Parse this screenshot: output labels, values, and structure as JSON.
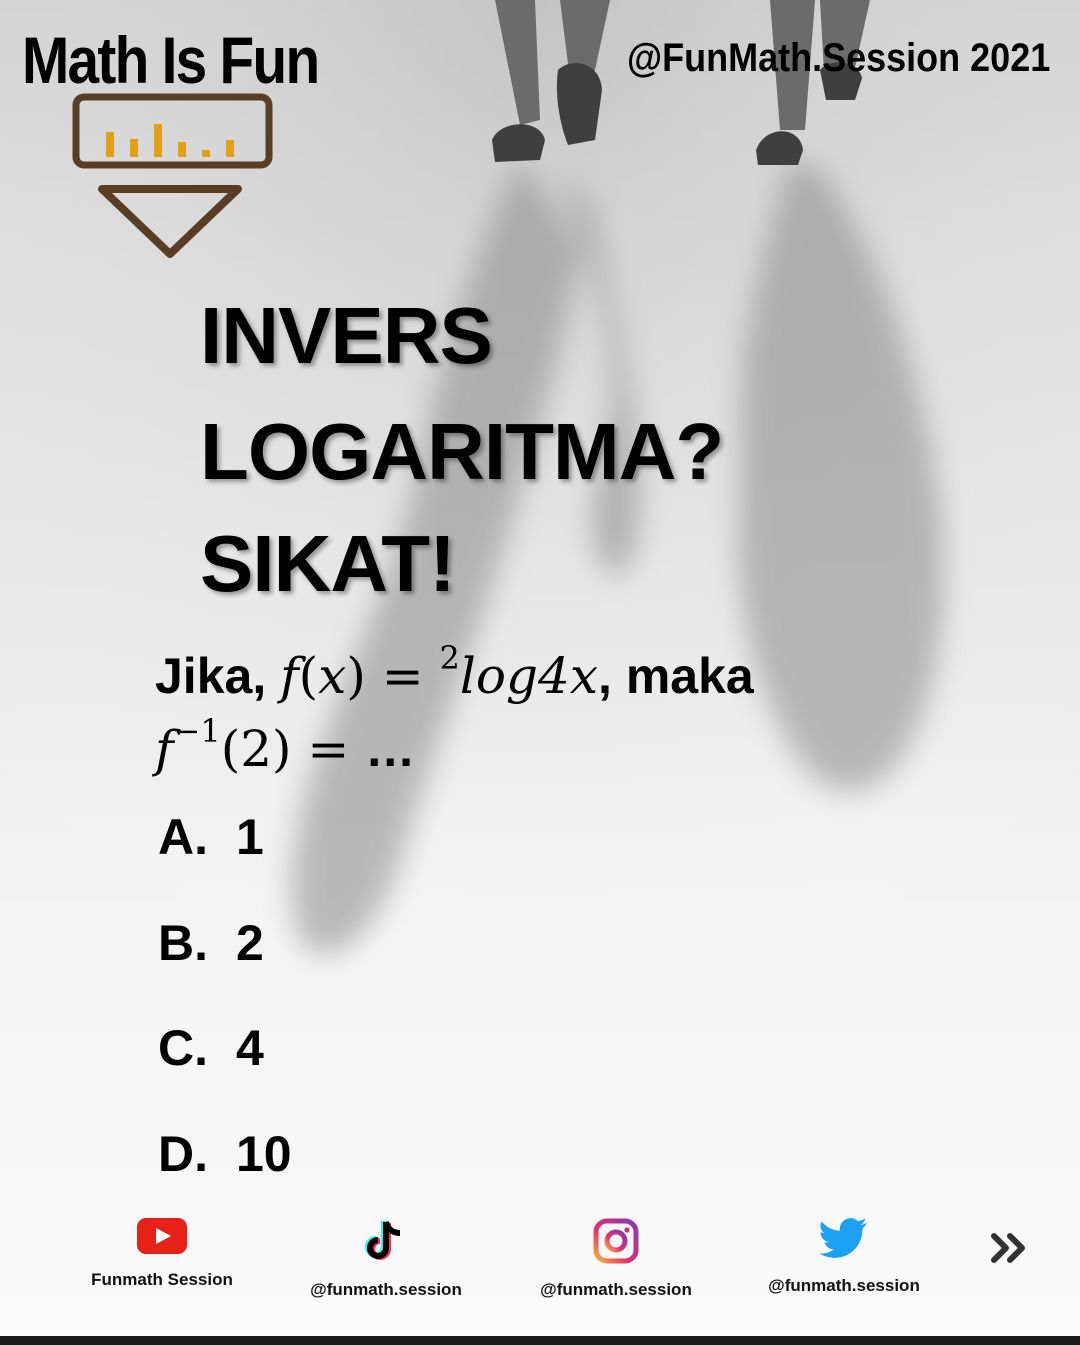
{
  "header": {
    "brand": "Math Is Fun",
    "handle": "@FunMath.Session 2021"
  },
  "title": {
    "line1": "INVERS",
    "line2": "LOGARITMA?",
    "line3": "SIKAT!"
  },
  "question": {
    "prefix": "Jika, ",
    "f": "f",
    "x_open": "(",
    "x": "x",
    "x_close": ")",
    "eq": " = ",
    "base": "2",
    "log": "log4",
    "log_x": "x",
    "suffix": ", maka",
    "inv_f": "f",
    "inv_sup": "−1",
    "inv_arg": "(2)",
    "inv_eq": " = ",
    "ellipsis": " …"
  },
  "options": [
    {
      "letter": "A.",
      "value": "1"
    },
    {
      "letter": "B.",
      "value": "2"
    },
    {
      "letter": "C.",
      "value": "4"
    },
    {
      "letter": "D.",
      "value": "10"
    }
  ],
  "social": [
    {
      "icon": "youtube-icon",
      "label": "Funmath Session",
      "color": "#e62117"
    },
    {
      "icon": "tiktok-icon",
      "label": "@funmath.session",
      "color": "#000000"
    },
    {
      "icon": "instagram-icon",
      "label": "@funmath.session",
      "color": "#c13584"
    },
    {
      "icon": "twitter-icon",
      "label": "@funmath.session",
      "color": "#1da1f2"
    }
  ],
  "colors": {
    "logo_brown": "#5a3d25",
    "logo_gold": "#e3a016"
  }
}
